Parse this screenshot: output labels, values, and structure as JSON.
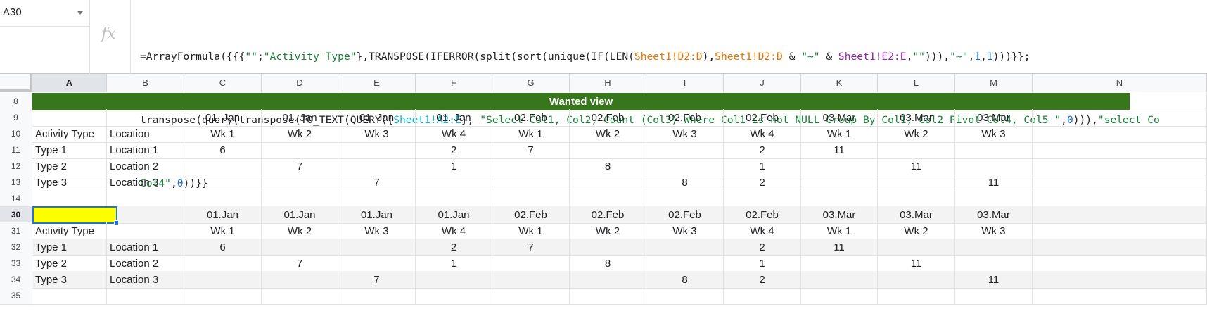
{
  "name_box": {
    "value": "A30"
  },
  "formula": {
    "fx_label": "fx",
    "line1": [
      {
        "t": "=ArrayFormula({{{",
        "k": ""
      },
      {
        "t": "\"\"",
        "k": "str"
      },
      {
        "t": ";",
        "k": ""
      },
      {
        "t": "\"Activity Type\"",
        "k": "str"
      },
      {
        "t": "},TRANSPOSE(IFERROR(split(sort(unique(IF(LEN(",
        "k": ""
      },
      {
        "t": "Sheet1!D2:D",
        "k": "r1"
      },
      {
        "t": "),",
        "k": ""
      },
      {
        "t": "Sheet1!D2:D",
        "k": "r1"
      },
      {
        "t": " & ",
        "k": ""
      },
      {
        "t": "\"~\"",
        "k": "str"
      },
      {
        "t": " & ",
        "k": ""
      },
      {
        "t": "Sheet1!E2:E",
        "k": "r2"
      },
      {
        "t": ",",
        "k": ""
      },
      {
        "t": "\"\"",
        "k": "str"
      },
      {
        "t": "))),",
        "k": ""
      },
      {
        "t": "\"~\"",
        "k": "str"
      },
      {
        "t": ",",
        "k": ""
      },
      {
        "t": "1",
        "k": "num"
      },
      {
        "t": ",",
        "k": ""
      },
      {
        "t": "1",
        "k": "num"
      },
      {
        "t": ")))}};",
        "k": ""
      }
    ],
    "line2": [
      {
        "t": "transpose(query(transpose(TO_TEXT(QUERY({",
        "k": ""
      },
      {
        "t": "Sheet1!A2:E",
        "k": "r3"
      },
      {
        "t": "}, ",
        "k": ""
      },
      {
        "t": "\"Select Col1, Col2, Count (Col3) Where Col1 is not NULL Group By Col1, Col2 Pivot Col4, Col5 \"",
        "k": "str"
      },
      {
        "t": ",",
        "k": ""
      },
      {
        "t": "0",
        "k": "num"
      },
      {
        "t": "))),",
        "k": ""
      },
      {
        "t": "\"select Co",
        "k": "str"
      }
    ],
    "line3": [
      {
        "t": "Col4\"",
        "k": "str"
      },
      {
        "t": ",",
        "k": ""
      },
      {
        "t": "0",
        "k": "num"
      },
      {
        "t": "))}}",
        "k": ""
      }
    ]
  },
  "columns": [
    "A",
    "B",
    "C",
    "D",
    "E",
    "F",
    "G",
    "H",
    "I",
    "J",
    "K",
    "L",
    "M",
    "N"
  ],
  "selected_column": "A",
  "wanted_view": {
    "title": "Wanted view",
    "title_row": "8",
    "rows": [
      {
        "num": "9",
        "cells": [
          "",
          "",
          "01. Jan",
          "01. Jan",
          "01. Jan",
          "01. Jan",
          "02.Feb",
          "02.Feb",
          "02.Feb",
          "02.Feb",
          "03.Mar",
          "03.Mar",
          "03.Mar",
          ""
        ]
      },
      {
        "num": "10",
        "cells": [
          "Activity Type",
          "Location",
          "Wk 1",
          "Wk 2",
          "Wk 3",
          "Wk 4",
          "Wk 1",
          "Wk 2",
          "Wk 3",
          "Wk 4",
          "Wk 1",
          "Wk 2",
          "Wk 3",
          ""
        ]
      },
      {
        "num": "11",
        "cells": [
          "Type 1",
          "Location 1",
          "6",
          "",
          "",
          "2",
          "7",
          "",
          "",
          "2",
          "11",
          "",
          "",
          ""
        ]
      },
      {
        "num": "12",
        "cells": [
          "Type 2",
          "Location 2",
          "",
          "7",
          "",
          "1",
          "",
          "8",
          "",
          "1",
          "",
          "11",
          "",
          ""
        ]
      },
      {
        "num": "13",
        "cells": [
          "Type 3",
          "Location 3",
          "",
          "",
          "7",
          "",
          "",
          "",
          "8",
          "2",
          "",
          "",
          "11",
          ""
        ]
      },
      {
        "num": "14",
        "cells": [
          "",
          "",
          "",
          "",
          "",
          "",
          "",
          "",
          "",
          "",
          "",
          "",
          "",
          ""
        ]
      }
    ]
  },
  "result_view": {
    "rows": [
      {
        "num": "30",
        "cells": [
          "",
          "",
          "01.Jan",
          "01.Jan",
          "01.Jan",
          "01.Jan",
          "02.Feb",
          "02.Feb",
          "02.Feb",
          "02.Feb",
          "03.Mar",
          "03.Mar",
          "03.Mar",
          ""
        ]
      },
      {
        "num": "31",
        "cells": [
          "Activity Type",
          "",
          "Wk 1",
          "Wk 2",
          "Wk 3",
          "Wk 4",
          "Wk 1",
          "Wk 2",
          "Wk 3",
          "Wk 4",
          "Wk 1",
          "Wk 2",
          "Wk 3",
          ""
        ]
      },
      {
        "num": "32",
        "cells": [
          "Type 1",
          "Location 1",
          "6",
          "",
          "",
          "2",
          "7",
          "",
          "",
          "2",
          "11",
          "",
          "",
          ""
        ]
      },
      {
        "num": "33",
        "cells": [
          "Type 2",
          "Location 2",
          "",
          "7",
          "",
          "1",
          "",
          "8",
          "",
          "1",
          "",
          "11",
          "",
          ""
        ]
      },
      {
        "num": "34",
        "cells": [
          "Type 3",
          "Location 3",
          "",
          "",
          "7",
          "",
          "",
          "",
          "8",
          "2",
          "",
          "",
          "11",
          ""
        ]
      },
      {
        "num": "35",
        "cells": [
          "",
          "",
          "",
          "",
          "",
          "",
          "",
          "",
          "",
          "",
          "",
          "",
          "",
          ""
        ]
      }
    ]
  },
  "colors": {
    "title_bg": "#38761d",
    "selected_cell_bg": "#ffff00",
    "selection_border": "#1a73e8",
    "result_band": "#f3f3f3"
  }
}
